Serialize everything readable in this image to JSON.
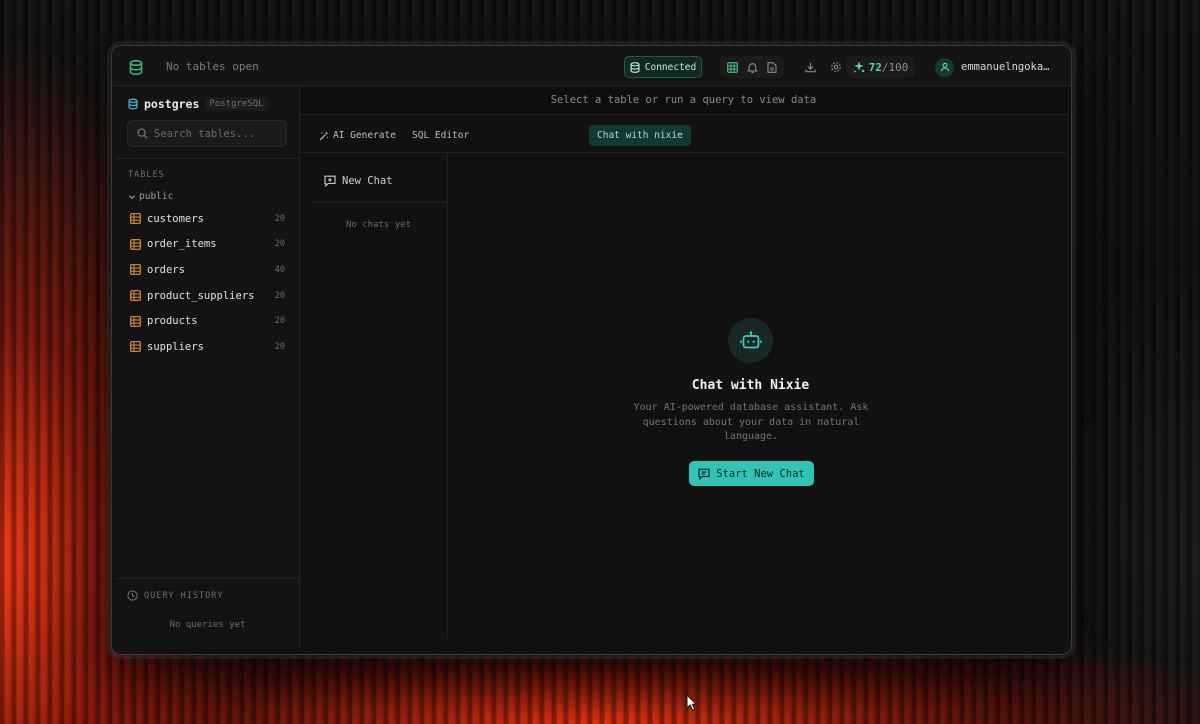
{
  "topbar": {
    "tabs_empty": "No tables open",
    "connection_status": "Connected",
    "score_value": "72",
    "score_max": "/100",
    "username": "emmanuelngoka…"
  },
  "sidebar": {
    "database_name": "postgres",
    "database_type": "PostgreSQL",
    "search_placeholder": "Search tables...",
    "section_label": "TABLES",
    "schema_name": "public",
    "tables": [
      {
        "name": "customers",
        "count": "20"
      },
      {
        "name": "order_items",
        "count": "20"
      },
      {
        "name": "orders",
        "count": "40"
      },
      {
        "name": "product_suppliers",
        "count": "20"
      },
      {
        "name": "products",
        "count": "20"
      },
      {
        "name": "suppliers",
        "count": "20"
      }
    ],
    "query_history_label": "QUERY HISTORY",
    "query_history_empty": "No queries yet"
  },
  "main": {
    "hint": "Select a table or run a query to view data",
    "tabs": [
      {
        "label": "AI Generate"
      },
      {
        "label": "SQL Editor"
      },
      {
        "label": "Chat with nixie"
      }
    ],
    "new_chat_label": "New Chat",
    "no_chats": "No chats yet",
    "chat_title": "Chat with Nixie",
    "chat_subtitle": "Your AI-powered database assistant. Ask questions about your data in natural language.",
    "start_button": "Start New Chat"
  },
  "colors": {
    "accent": "#2ec4b6",
    "success": "#4fd6a2",
    "table_icon": "#e0913a",
    "background_glow": "#ff3c14"
  },
  "icons": [
    "database-icon",
    "table-icon",
    "bell-icon",
    "file-icon",
    "download-icon",
    "gear-icon",
    "sparkle-icon",
    "user-icon",
    "search-icon",
    "chevron-down-icon",
    "clock-icon",
    "wand-icon",
    "chat-plus-icon",
    "bot-icon"
  ]
}
